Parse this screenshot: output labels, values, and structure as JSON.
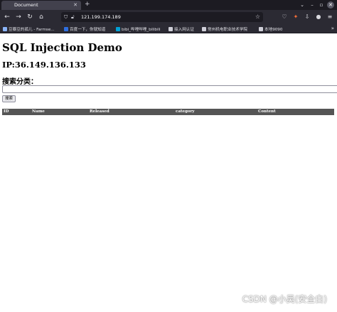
{
  "browser": {
    "tab": {
      "title": "Document"
    },
    "url": "121.199.174.189",
    "bookmarks": [
      {
        "label": "豆瓣豆的孤儿 - Farmse...",
        "color": "#8ab4f8"
      },
      {
        "label": "百度一下，你就知道",
        "color": "#2f6fe0"
      },
      {
        "label": "bibi_哔哩哔哩_bilibili",
        "color": "#00a1d6"
      },
      {
        "label": "接入网认证",
        "color": "#cfcfd8"
      },
      {
        "label": "常州机电职业技术学院",
        "color": "#cfcfd8"
      },
      {
        "label": "本地9090",
        "color": "#cfcfd8"
      }
    ]
  },
  "page": {
    "title": "SQL Injection Demo",
    "ip": "IP:36.149.136.133",
    "search": {
      "label": "搜索分类：",
      "value": "",
      "button_label": "搜索"
    },
    "table": {
      "columns": [
        "ID",
        "Name",
        "Released",
        "category",
        "Content"
      ],
      "rows": []
    }
  },
  "watermark": "CSDN @小吴(安全白)"
}
